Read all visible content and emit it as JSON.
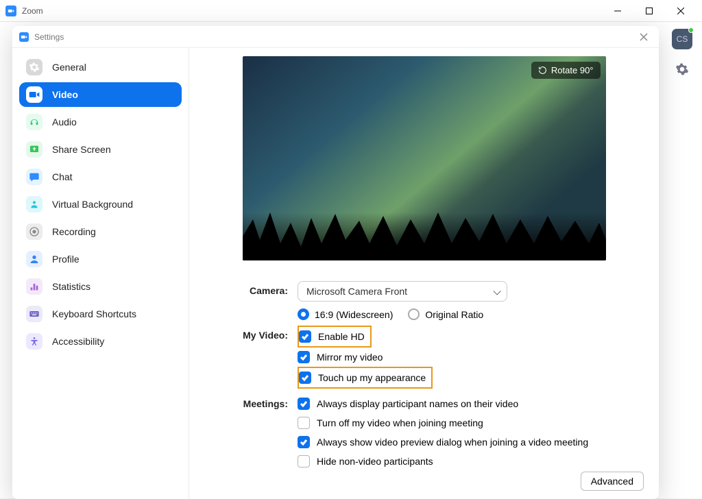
{
  "window": {
    "title": "Zoom"
  },
  "avatar": {
    "initials": "CS"
  },
  "dialog": {
    "title": "Settings"
  },
  "sidebar": {
    "items": [
      {
        "label": "General",
        "icon": "gear",
        "color": "#d9d9d9",
        "fg": "#fff"
      },
      {
        "label": "Video",
        "icon": "video",
        "color": "#ffffff",
        "fg": "#0e72ed",
        "active": true
      },
      {
        "label": "Audio",
        "icon": "audio",
        "color": "#e6faf0",
        "fg": "#2fc779"
      },
      {
        "label": "Share Screen",
        "icon": "share",
        "color": "#e6f8ec",
        "fg": "#34c759"
      },
      {
        "label": "Chat",
        "icon": "chat",
        "color": "#e5f3ff",
        "fg": "#2d8cff"
      },
      {
        "label": "Virtual Background",
        "icon": "vbg",
        "color": "#def7fb",
        "fg": "#26c4da"
      },
      {
        "label": "Recording",
        "icon": "rec",
        "color": "#ececec",
        "fg": "#888"
      },
      {
        "label": "Profile",
        "icon": "profile",
        "color": "#e5f0ff",
        "fg": "#3484f0"
      },
      {
        "label": "Statistics",
        "icon": "stats",
        "color": "#f3e9fb",
        "fg": "#a561d8"
      },
      {
        "label": "Keyboard Shortcuts",
        "icon": "kbd",
        "color": "#ece9f8",
        "fg": "#6b60c5"
      },
      {
        "label": "Accessibility",
        "icon": "a11y",
        "color": "#ece9ff",
        "fg": "#7668e5"
      }
    ]
  },
  "video": {
    "rotate": "Rotate 90°",
    "camera_label": "Camera:",
    "camera_value": "Microsoft Camera Front",
    "ratio_wide": "16:9 (Widescreen)",
    "ratio_orig": "Original Ratio",
    "myvideo_label": "My Video:",
    "enable_hd": "Enable HD",
    "mirror": "Mirror my video",
    "touchup": "Touch up my appearance",
    "meetings_label": "Meetings:",
    "m1": "Always display participant names on their video",
    "m2": "Turn off my video when joining meeting",
    "m3": "Always show video preview dialog when joining a video meeting",
    "m4": "Hide non-video participants",
    "advanced": "Advanced"
  }
}
